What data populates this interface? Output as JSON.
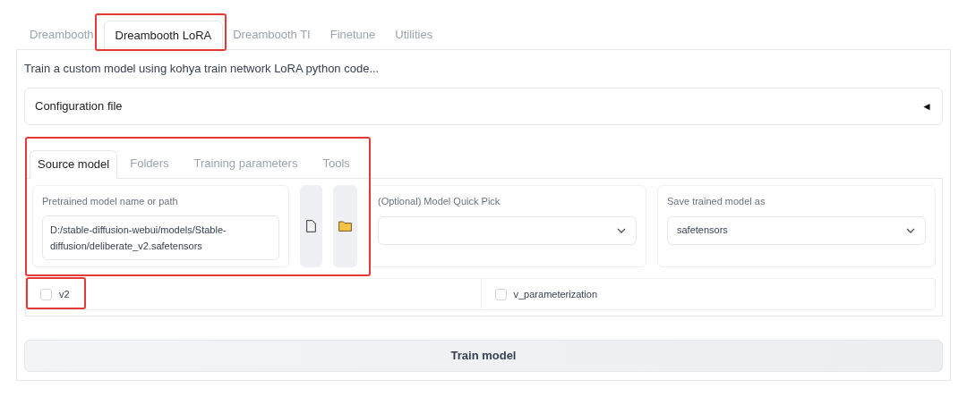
{
  "main_tabs": [
    {
      "label": "Dreambooth",
      "selected": false,
      "highlighted": false
    },
    {
      "label": "Dreambooth LoRA",
      "selected": true,
      "highlighted": true
    },
    {
      "label": "Dreambooth TI",
      "selected": false,
      "highlighted": false
    },
    {
      "label": "Finetune",
      "selected": false,
      "highlighted": false
    },
    {
      "label": "Utilities",
      "selected": false,
      "highlighted": false
    }
  ],
  "description": "Train a custom model using kohya train network LoRA python code...",
  "config_accordion": {
    "label": "Configuration file",
    "toggle": "◄"
  },
  "source_section_highlighted": true,
  "sub_tabs": [
    {
      "label": "Source model",
      "selected": true
    },
    {
      "label": "Folders",
      "selected": false
    },
    {
      "label": "Training parameters",
      "selected": false
    },
    {
      "label": "Tools",
      "selected": false
    }
  ],
  "pretrained_field": {
    "label": "Pretrained model name or path",
    "value": "D:/stable-diffusion-webui/models/Stable-diffusion/deliberate_v2.safetensors"
  },
  "dropdowns": [
    {
      "label": "(Optional) Model Quick Pick"
    },
    {
      "label": "Save trained model as",
      "value": "safetensors"
    }
  ],
  "checkboxes": [
    {
      "label": "v2",
      "checked": false,
      "highlighted": true
    },
    {
      "label": "v_parameterization",
      "checked": false,
      "highlighted": false
    }
  ],
  "train_button": "Train model"
}
